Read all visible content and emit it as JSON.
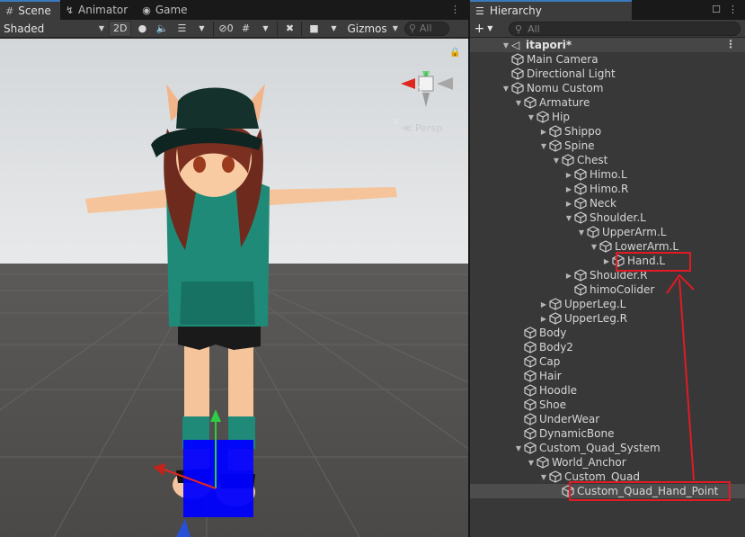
{
  "scene_tabs": [
    {
      "label": "Scene",
      "icon": "grid-icon",
      "active": true
    },
    {
      "label": "Animator",
      "icon": "animator-icon",
      "active": false
    },
    {
      "label": "Game",
      "icon": "gamepad-icon",
      "active": false
    }
  ],
  "scene_toolbar": {
    "draw_mode": "Shaded",
    "mode_2d": "2D",
    "hidden_count": "0",
    "gizmos": "Gizmos",
    "search_placeholder": "All"
  },
  "viewport": {
    "projection_label": "Persp",
    "axis_y": "y",
    "axis_x": "x"
  },
  "hierarchy": {
    "tab_label": "Hierarchy",
    "search_placeholder": "All",
    "scene_name": "itapori*",
    "rows": [
      {
        "label": "Main Camera",
        "depth": 1,
        "fold": "none"
      },
      {
        "label": "Directional Light",
        "depth": 1,
        "fold": "none"
      },
      {
        "label": "Nomu Custom",
        "depth": 1,
        "fold": "open"
      },
      {
        "label": "Armature",
        "depth": 2,
        "fold": "open"
      },
      {
        "label": "Hip",
        "depth": 3,
        "fold": "open"
      },
      {
        "label": "Shippo",
        "depth": 4,
        "fold": "closed"
      },
      {
        "label": "Spine",
        "depth": 4,
        "fold": "open"
      },
      {
        "label": "Chest",
        "depth": 5,
        "fold": "open"
      },
      {
        "label": "Himo.L",
        "depth": 6,
        "fold": "closed"
      },
      {
        "label": "Himo.R",
        "depth": 6,
        "fold": "closed"
      },
      {
        "label": "Neck",
        "depth": 6,
        "fold": "closed"
      },
      {
        "label": "Shoulder.L",
        "depth": 6,
        "fold": "open"
      },
      {
        "label": "UpperArm.L",
        "depth": 7,
        "fold": "open"
      },
      {
        "label": "LowerArm.L",
        "depth": 8,
        "fold": "open"
      },
      {
        "label": "Hand.L",
        "depth": 9,
        "fold": "closed"
      },
      {
        "label": "Shoulder.R",
        "depth": 6,
        "fold": "closed"
      },
      {
        "label": "himoColider",
        "depth": 6,
        "fold": "none"
      },
      {
        "label": "UpperLeg.L",
        "depth": 4,
        "fold": "closed"
      },
      {
        "label": "UpperLeg.R",
        "depth": 4,
        "fold": "closed"
      },
      {
        "label": "Body",
        "depth": 2,
        "fold": "none"
      },
      {
        "label": "Body2",
        "depth": 2,
        "fold": "none"
      },
      {
        "label": "Cap",
        "depth": 2,
        "fold": "none"
      },
      {
        "label": "Hair",
        "depth": 2,
        "fold": "none"
      },
      {
        "label": "Hoodle",
        "depth": 2,
        "fold": "none"
      },
      {
        "label": "Shoe",
        "depth": 2,
        "fold": "none"
      },
      {
        "label": "UnderWear",
        "depth": 2,
        "fold": "none"
      },
      {
        "label": "DynamicBone",
        "depth": 2,
        "fold": "none"
      },
      {
        "label": "Custom_Quad_System",
        "depth": 2,
        "fold": "open"
      },
      {
        "label": "World_Anchor",
        "depth": 3,
        "fold": "open"
      },
      {
        "label": "Custom_Quad",
        "depth": 4,
        "fold": "open"
      },
      {
        "label": "Custom_Quad_Hand_Point",
        "depth": 5,
        "fold": "none",
        "selected": true
      }
    ]
  },
  "colors": {
    "annotation": "#e01b24",
    "accent": "#3a79bb",
    "model_outfit": "#1f8a78"
  }
}
